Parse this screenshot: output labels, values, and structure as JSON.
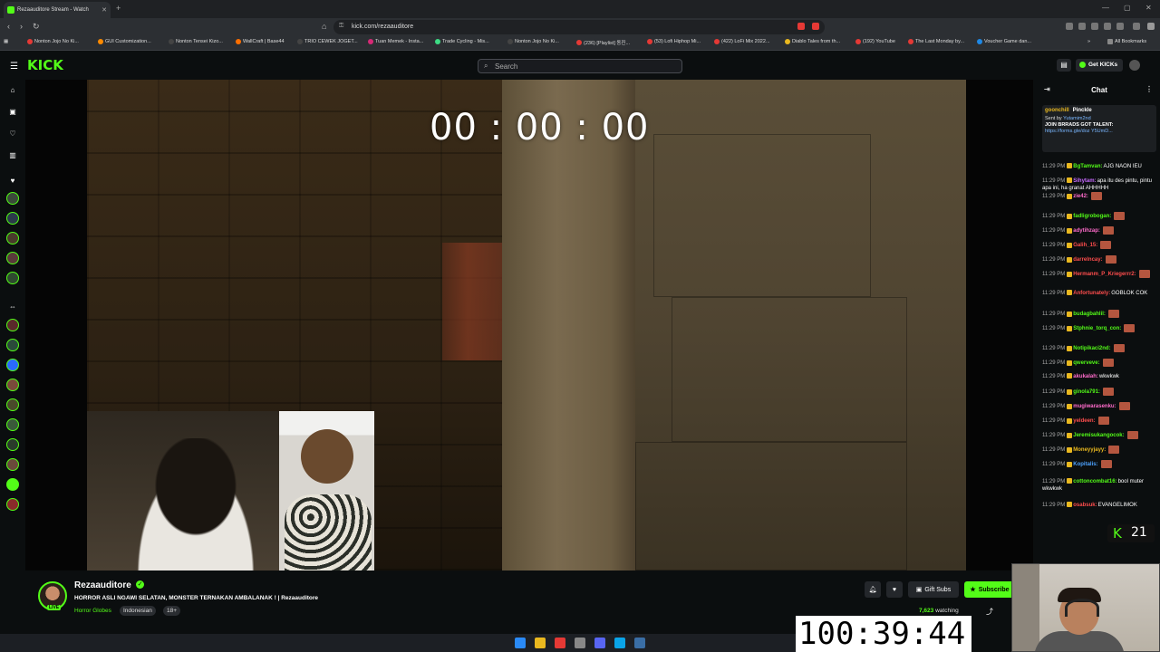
{
  "browser": {
    "tab_title": "Rezaauditore Stream - Watch",
    "url": "kick.com/rezaauditore",
    "bookmarks": [
      "Nonton Jojo No Ki...",
      "GUI Customization...",
      "Nonton Tensei Kizo...",
      "WallCraft | Base44",
      "TRIO CEWEK JOGET...",
      "Tuan Memek - Insta...",
      "Trade Cycling - Mis...",
      "Nonton Jojo No Ki...",
      "(236) [Playlist] 동진...",
      "(53) Lofi Hiphop Mi...",
      "(422) LoFi Mix 2022...",
      "Diablo Tales from th...",
      "(192) YouTube",
      "The Last Monday by...",
      "Voucher Game dan...",
      "All Bookmarks"
    ]
  },
  "header": {
    "logo": "KICK",
    "search_placeholder": "Search",
    "get_kicks": "Get KICKs"
  },
  "video": {
    "overlay_timer": "00 : 00 : 00"
  },
  "chat": {
    "title": "Chat",
    "pinned_top": [
      "goonchill",
      "Pinckle"
    ],
    "pinned_sender": "Sent by",
    "pinned_sender_name": "Yutamim2nd",
    "pinned_text": "JOIN BRRADS GOT TALENT:",
    "pinned_link": "https://forms.gle/doz Y5UmD...",
    "messages": [
      {
        "time": "11:29 PM",
        "user": "BgTamvan:",
        "color": "#53fc18",
        "text": "AJG NAON IEU",
        "emote": false
      },
      {
        "time": "11:29 PM",
        "user": "Sihytam:",
        "color": "#c86bff",
        "text": "apa itu des pintu, pintu apa ini, ha granat AHHHHH",
        "emote": false
      },
      {
        "time": "11:29 PM",
        "user": "zie42:",
        "color": "#ff6bcb",
        "text": "",
        "emote": true
      },
      {
        "time": "11:29 PM",
        "user": "fadligrobogan:",
        "color": "#53fc18",
        "text": "",
        "emote": true
      },
      {
        "time": "11:29 PM",
        "user": "adytihzap:",
        "color": "#ff6bcb",
        "text": "",
        "emote": true
      },
      {
        "time": "11:29 PM",
        "user": "Galih_15:",
        "color": "#ff4d4d",
        "text": "",
        "emote": true
      },
      {
        "time": "11:29 PM",
        "user": "darrelncay:",
        "color": "#ff4d4d",
        "text": "",
        "emote": true
      },
      {
        "time": "11:29 PM",
        "user": "Hermanm_P_Kriegerrr2:",
        "color": "#ff4d4d",
        "text": "",
        "emote": true
      },
      {
        "time": "11:29 PM",
        "user": "Anfortunately:",
        "color": "#ff4d4d",
        "text": "GOBLOK COK",
        "emote": false
      },
      {
        "time": "11:29 PM",
        "user": "budagbahlil:",
        "color": "#53fc18",
        "text": "",
        "emote": true
      },
      {
        "time": "11:29 PM",
        "user": "Stphnie_torq_con:",
        "color": "#53fc18",
        "text": "",
        "emote": true
      },
      {
        "time": "11:29 PM",
        "user": "Notipikaci2nd:",
        "color": "#53fc18",
        "text": "",
        "emote": true
      },
      {
        "time": "11:29 PM",
        "user": "qwerveve:",
        "color": "#53fc18",
        "text": "",
        "emote": true
      },
      {
        "time": "11:29 PM",
        "user": "akukalah:",
        "color": "#ff6bcb",
        "text": "wkwkwk",
        "emote": false
      },
      {
        "time": "11:29 PM",
        "user": "ginola791:",
        "color": "#53fc18",
        "text": "",
        "emote": true
      },
      {
        "time": "11:29 PM",
        "user": "mugiwarasenku:",
        "color": "#ff6bcb",
        "text": "",
        "emote": true
      },
      {
        "time": "11:29 PM",
        "user": "yeldeen:",
        "color": "#ff4d4d",
        "text": "",
        "emote": true
      },
      {
        "time": "11:29 PM",
        "user": "Jeremisukangocok:",
        "color": "#53fc18",
        "text": "",
        "emote": true
      },
      {
        "time": "11:29 PM",
        "user": "Moneyyjayy:",
        "color": "#e9b81f",
        "text": "",
        "emote": true
      },
      {
        "time": "11:29 PM",
        "user": "Kopitalis:",
        "color": "#4da3ff",
        "text": "",
        "emote": true
      },
      {
        "time": "11:29 PM",
        "user": "cottoncombat16:",
        "color": "#53fc18",
        "text": "bool muter wkwkwk",
        "emote": false
      },
      {
        "time": "11:29 PM",
        "user": "osabsuk:",
        "color": "#ff4d4d",
        "text": "EVANGELIMOK",
        "emote": false
      }
    ],
    "kick_count": "21"
  },
  "stream": {
    "channel": "Rezaauditore",
    "title": "HORROR ASLI NGAWI SELATAN, MONSTER TERNAKAN AMBALANAK ! | Rezaauditore",
    "category": "Horror Globes",
    "tags": [
      "Indonesian",
      "18+"
    ],
    "gift_subs": "Gift Subs",
    "subscribe": "Subscribe",
    "viewers": "7,623",
    "watching": "watching",
    "live": "LIVE"
  },
  "overlay_timer_big": "100:39:44",
  "colors": {
    "accent": "#53fc18",
    "background": "#0b0e0f"
  }
}
